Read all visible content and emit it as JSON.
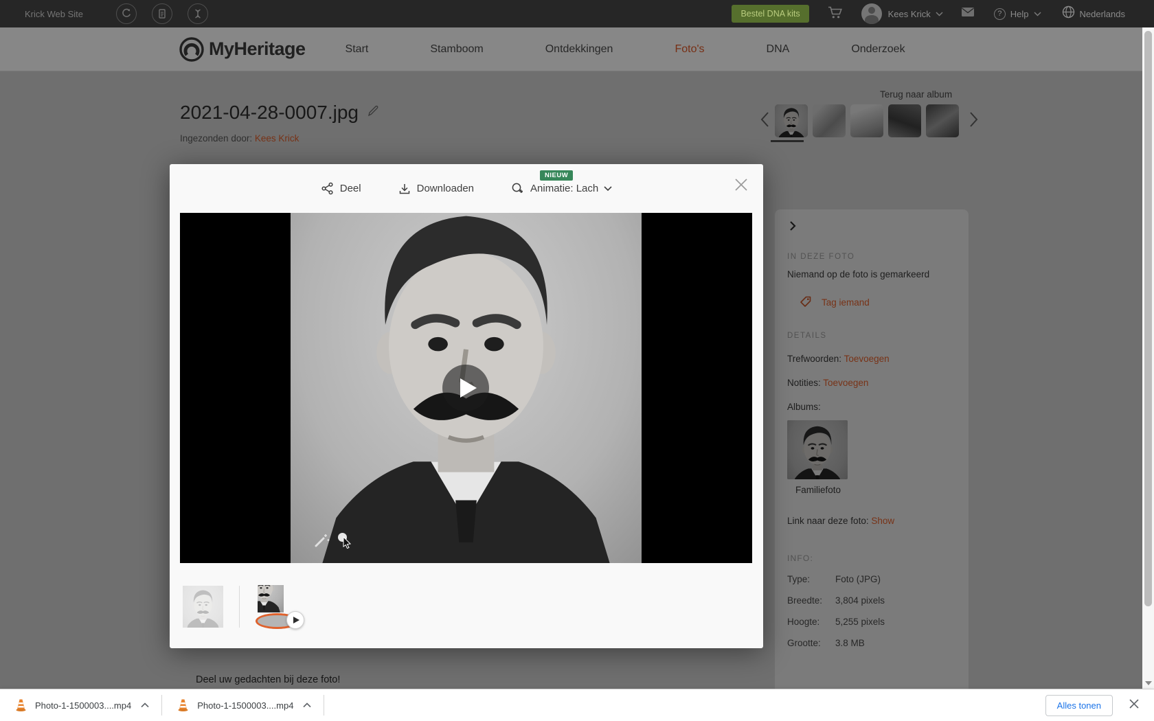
{
  "top_bar": {
    "site_name": "Krick Web Site",
    "order_button_label": "Bestel DNA kits",
    "user_name": "Kees Krick",
    "help_label": "Help",
    "language_label": "Nederlands"
  },
  "nav": {
    "brand": "MyHeritage",
    "items": [
      {
        "label": "Start",
        "active": false
      },
      {
        "label": "Stamboom",
        "active": false
      },
      {
        "label": "Ontdekkingen",
        "active": false
      },
      {
        "label": "Foto's",
        "active": true
      },
      {
        "label": "DNA",
        "active": false
      },
      {
        "label": "Onderzoek",
        "active": false
      }
    ]
  },
  "page": {
    "photo_title": "2021-04-28-0007.jpg",
    "submitted_by_label": "Ingezonden door:",
    "submitted_by_name": "Kees Krick",
    "back_to_album_label": "Terug naar album",
    "comment_prompt": "Deel uw gedachten bij deze foto!"
  },
  "viewer": {
    "share_label": "Deel",
    "download_label": "Downloaden",
    "new_badge": "NIEUW",
    "animation_label": "Animatie: Lach"
  },
  "sidebar": {
    "in_this_photo_title": "IN DEZE FOTO",
    "no_tags_text": "Niemand op de foto is gemarkeerd",
    "tag_someone_label": "Tag iemand",
    "details_title": "DETAILS",
    "keywords_label": "Trefwoorden:",
    "keywords_action": "Toevoegen",
    "notes_label": "Notities:",
    "notes_action": "Toevoegen",
    "albums_label": "Albums:",
    "album_name": "Familiefoto",
    "link_label": "Link naar deze foto:",
    "link_action": "Show",
    "info_title": "INFO:",
    "info_rows": [
      {
        "label": "Type:",
        "value": "Foto (JPG)"
      },
      {
        "label": "Breedte:",
        "value": "3,804 pixels"
      },
      {
        "label": "Hoogte:",
        "value": "5,255 pixels"
      },
      {
        "label": "Grootte:",
        "value": "3.8 MB"
      }
    ]
  },
  "downloads_bar": {
    "items": [
      {
        "name": "Photo-1-1500003....mp4"
      },
      {
        "name": "Photo-1-1500003....mp4"
      }
    ],
    "show_all_label": "Alles tonen"
  },
  "colors": {
    "accent_orange": "#e2602c",
    "badge_green": "#37875a",
    "cta_green": "#566f2d",
    "link_blue": "#1a73e8",
    "topbar_bg": "#262626"
  }
}
